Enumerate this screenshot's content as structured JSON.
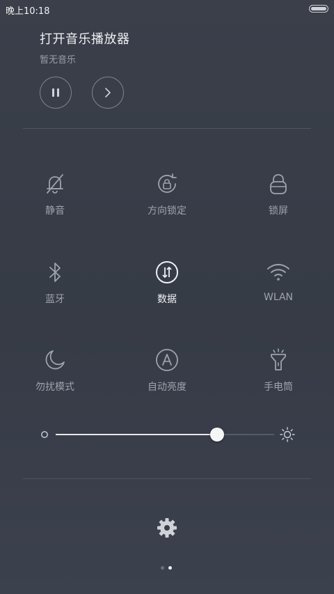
{
  "status_bar": {
    "time": "晚上10:18",
    "battery_level": 1.0
  },
  "music": {
    "title": "打开音乐播放器",
    "subtitle": "暂无音乐"
  },
  "tiles": [
    {
      "label": "静音",
      "icon": "bell-off-icon",
      "active": false
    },
    {
      "label": "方向锁定",
      "icon": "rotation-lock-icon",
      "active": false
    },
    {
      "label": "锁屏",
      "icon": "lock-icon",
      "active": false
    },
    {
      "label": "蓝牙",
      "icon": "bluetooth-icon",
      "active": false
    },
    {
      "label": "数据",
      "icon": "mobile-data-icon",
      "active": true
    },
    {
      "label": "WLAN",
      "icon": "wifi-icon",
      "active": false
    },
    {
      "label": "勿扰模式",
      "icon": "moon-icon",
      "active": false
    },
    {
      "label": "自动亮度",
      "icon": "auto-brightness-icon",
      "active": false
    },
    {
      "label": "手电筒",
      "icon": "flashlight-icon",
      "active": false
    }
  ],
  "brightness": {
    "value": 0.74
  },
  "pager": {
    "count": 2,
    "current": 2
  },
  "colors": {
    "background": "#383d48",
    "active_text": "#f2f3f5",
    "inactive_text": "#9ea3ad"
  }
}
